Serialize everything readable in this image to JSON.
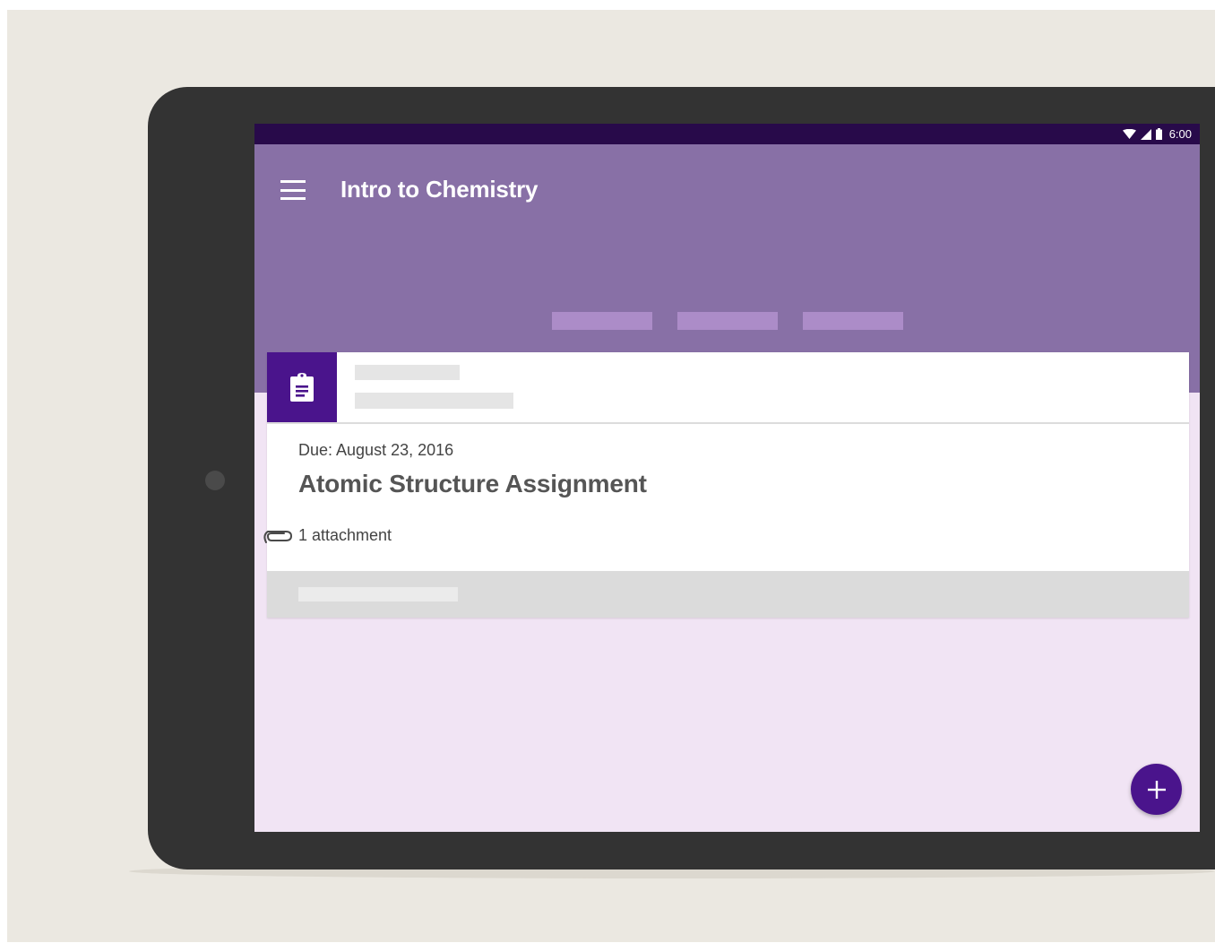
{
  "status_bar": {
    "time": "6:00",
    "icons": [
      "wifi-icon",
      "cell-signal-icon",
      "battery-icon"
    ]
  },
  "app_bar": {
    "menu_icon": "menu-icon",
    "title": "Intro to Chemistry",
    "tab_count": 3
  },
  "assignment_card": {
    "icon": "assignment-icon",
    "due": "Due: August 23, 2016",
    "title": "Atomic Structure Assignment",
    "attachment_icon": "paperclip-icon",
    "attachment_label": "1 attachment"
  },
  "fab": {
    "icon": "plus-icon"
  },
  "colors": {
    "background": "#ebe8e1",
    "device": "#333333",
    "status_bar": "#280a4a",
    "app_bar": "#8870a6",
    "tab_placeholder": "#ac8cc8",
    "screen_background": "#f1e4f4",
    "accent": "#4a148c",
    "card_footer": "#dbdbdb"
  }
}
